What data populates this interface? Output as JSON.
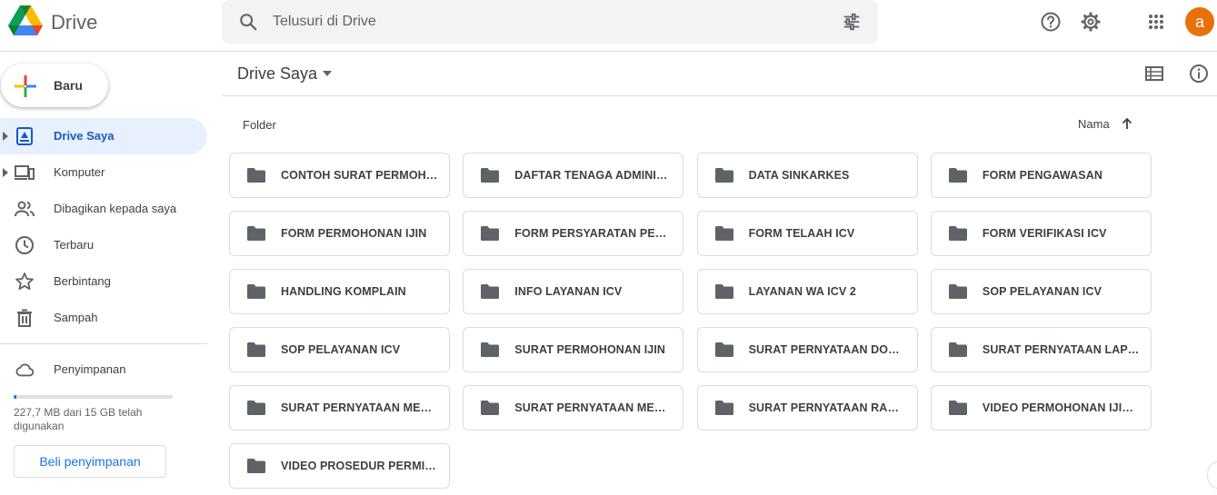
{
  "app": {
    "name": "Drive"
  },
  "search": {
    "placeholder": "Telusuri di Drive"
  },
  "header": {
    "avatar_letter": "a"
  },
  "sidebar": {
    "new_label": "Baru",
    "items": [
      {
        "label": "Drive Saya",
        "icon": "my-drive-icon",
        "active": true
      },
      {
        "label": "Komputer",
        "icon": "computer-icon"
      },
      {
        "label": "Dibagikan kepada saya",
        "icon": "shared-icon"
      },
      {
        "label": "Terbaru",
        "icon": "clock-icon"
      },
      {
        "label": "Berbintang",
        "icon": "star-icon"
      },
      {
        "label": "Sampah",
        "icon": "trash-icon"
      }
    ],
    "storage": {
      "label": "Penyimpanan",
      "usage_text": "227,7 MB dari 15 GB telah digunakan",
      "used_fraction": 0.015,
      "buy_label": "Beli penyimpanan"
    }
  },
  "main": {
    "title": "Drive Saya",
    "section_label": "Folder",
    "sort_label": "Nama",
    "folders": [
      "CONTOH SURAT PERMOHONAN",
      "DAFTAR TENAGA ADMINISTRASI",
      "DATA SINKARKES",
      "FORM PENGAWASAN",
      "FORM PERMOHONAN IJIN",
      "FORM PERSYARATAN PERMOHONAN",
      "FORM TELAAH ICV",
      "FORM VERIFIKASI ICV",
      "HANDLING KOMPLAIN",
      "INFO LAYANAN ICV",
      "LAYANAN WA ICV 2",
      "SOP PELAYANAN ICV",
      "SOP PELAYANAN ICV",
      "SURAT PERMOHONAN IJIN",
      "SURAT PERNYATAAN DOKTER",
      "SURAT PERNYATAAN LAPORAN",
      "SURAT PERNYATAAN MEMENUHI",
      "SURAT PERNYATAAN MEMILIKI",
      "SURAT PERNYATAAN RANTAI",
      "VIDEO PERMOHONAN IJIN ICV",
      "VIDEO PROSEDUR PERMINTAAN"
    ]
  },
  "colors": {
    "accent": "#1a73e8",
    "active_bg": "#e8f0fe",
    "avatar": "#e8710a",
    "folder_icon": "#5f6368"
  }
}
